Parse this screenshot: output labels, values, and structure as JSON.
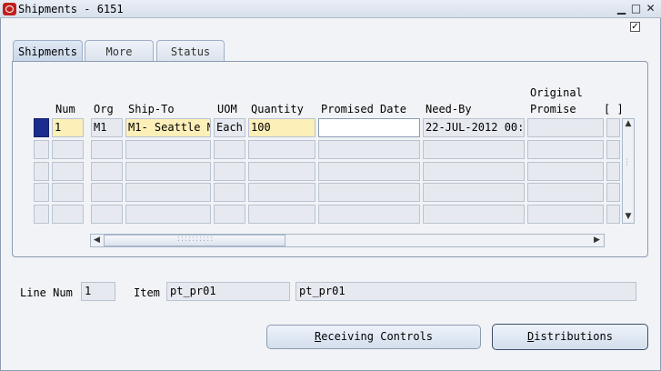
{
  "window": {
    "title": "Shipments - 6151",
    "controls": {
      "minimize": "▁",
      "maximize": "□",
      "close": "✕"
    }
  },
  "tabs": [
    {
      "label": "Shipments",
      "active": true
    },
    {
      "label": "More",
      "active": false
    },
    {
      "label": "Status",
      "active": false
    }
  ],
  "grid": {
    "headers": {
      "num": "Num",
      "org": "Org",
      "ship_to": "Ship-To",
      "uom": "UOM",
      "quantity": "Quantity",
      "promised_date": "Promised Date",
      "need_by": "Need-By",
      "original_promise_1": "Original",
      "original_promise_2": "Promise",
      "folder": "[ ]"
    },
    "rows": [
      {
        "num": "1",
        "org": "M1",
        "ship_to": "M1- Seattle M",
        "uom": "Each",
        "quantity": "100",
        "promised_date": "",
        "need_by": "22-JUL-2012 00:0",
        "original_promise": ""
      },
      {
        "num": "",
        "org": "",
        "ship_to": "",
        "uom": "",
        "quantity": "",
        "promised_date": "",
        "need_by": "",
        "original_promise": ""
      },
      {
        "num": "",
        "org": "",
        "ship_to": "",
        "uom": "",
        "quantity": "",
        "promised_date": "",
        "need_by": "",
        "original_promise": ""
      },
      {
        "num": "",
        "org": "",
        "ship_to": "",
        "uom": "",
        "quantity": "",
        "promised_date": "",
        "need_by": "",
        "original_promise": ""
      },
      {
        "num": "",
        "org": "",
        "ship_to": "",
        "uom": "",
        "quantity": "",
        "promised_date": "",
        "need_by": "",
        "original_promise": ""
      }
    ]
  },
  "footer": {
    "line_num_label": "Line Num",
    "line_num_value": "1",
    "item_label": "Item",
    "item_value": "pt_pr01",
    "item_description": "pt_pr01"
  },
  "buttons": {
    "receiving_controls": {
      "mnemonic": "R",
      "rest": "eceiving Controls"
    },
    "distributions": {
      "mnemonic": "D",
      "rest": "istributions"
    }
  },
  "colors": {
    "active_row_indicator": "#1c2c8c",
    "required_field": "#fcefb8",
    "disabled_field": "#e6e9ef"
  }
}
